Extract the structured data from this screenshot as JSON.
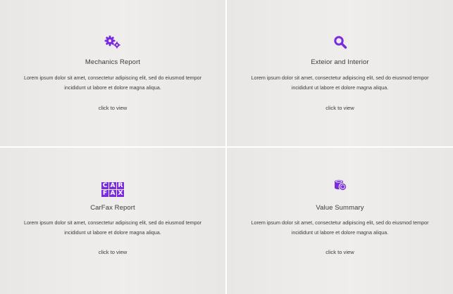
{
  "accent_color": "#7a2be0",
  "cards": [
    {
      "icon": "gears-icon",
      "title": "Mechanics Report",
      "desc_line1": "Lorem ipsum dolor sit amet, consectetur adipiscing elit, sed do eiusmod tempor",
      "desc_line2": "incididunt ut labore et dolore magna aliqua.",
      "cta": "click to view"
    },
    {
      "icon": "search-icon",
      "title": "Exteior and Interior",
      "desc_line1": "Lorem ipsum dolor sit amet, consectetur adipiscing elit, sed do eiusmod tempor",
      "desc_line2": "incididunt ut labore et dolore magna aliqua.",
      "cta": "click to view"
    },
    {
      "icon": "carfax-logo-icon",
      "logo_letters": [
        "C",
        "A",
        "R",
        "F",
        "A",
        "X"
      ],
      "title": "CarFax Report",
      "desc_line1": "Lorem ipsum dolor sit amet, consectetur adipiscing elit, sed do eiusmod tempor",
      "desc_line2": "incididunt ut labore et dolore magna aliqua.",
      "cta": "click to view"
    },
    {
      "icon": "coins-icon",
      "title": "Value Summary",
      "desc_line1": "Lorem ipsum dolor sit amet, consectetur adipiscing elit, sed do eiusmod tempor",
      "desc_line2": "incididunt ut labore et dolore magna aliqua.",
      "cta": "click to view"
    }
  ]
}
